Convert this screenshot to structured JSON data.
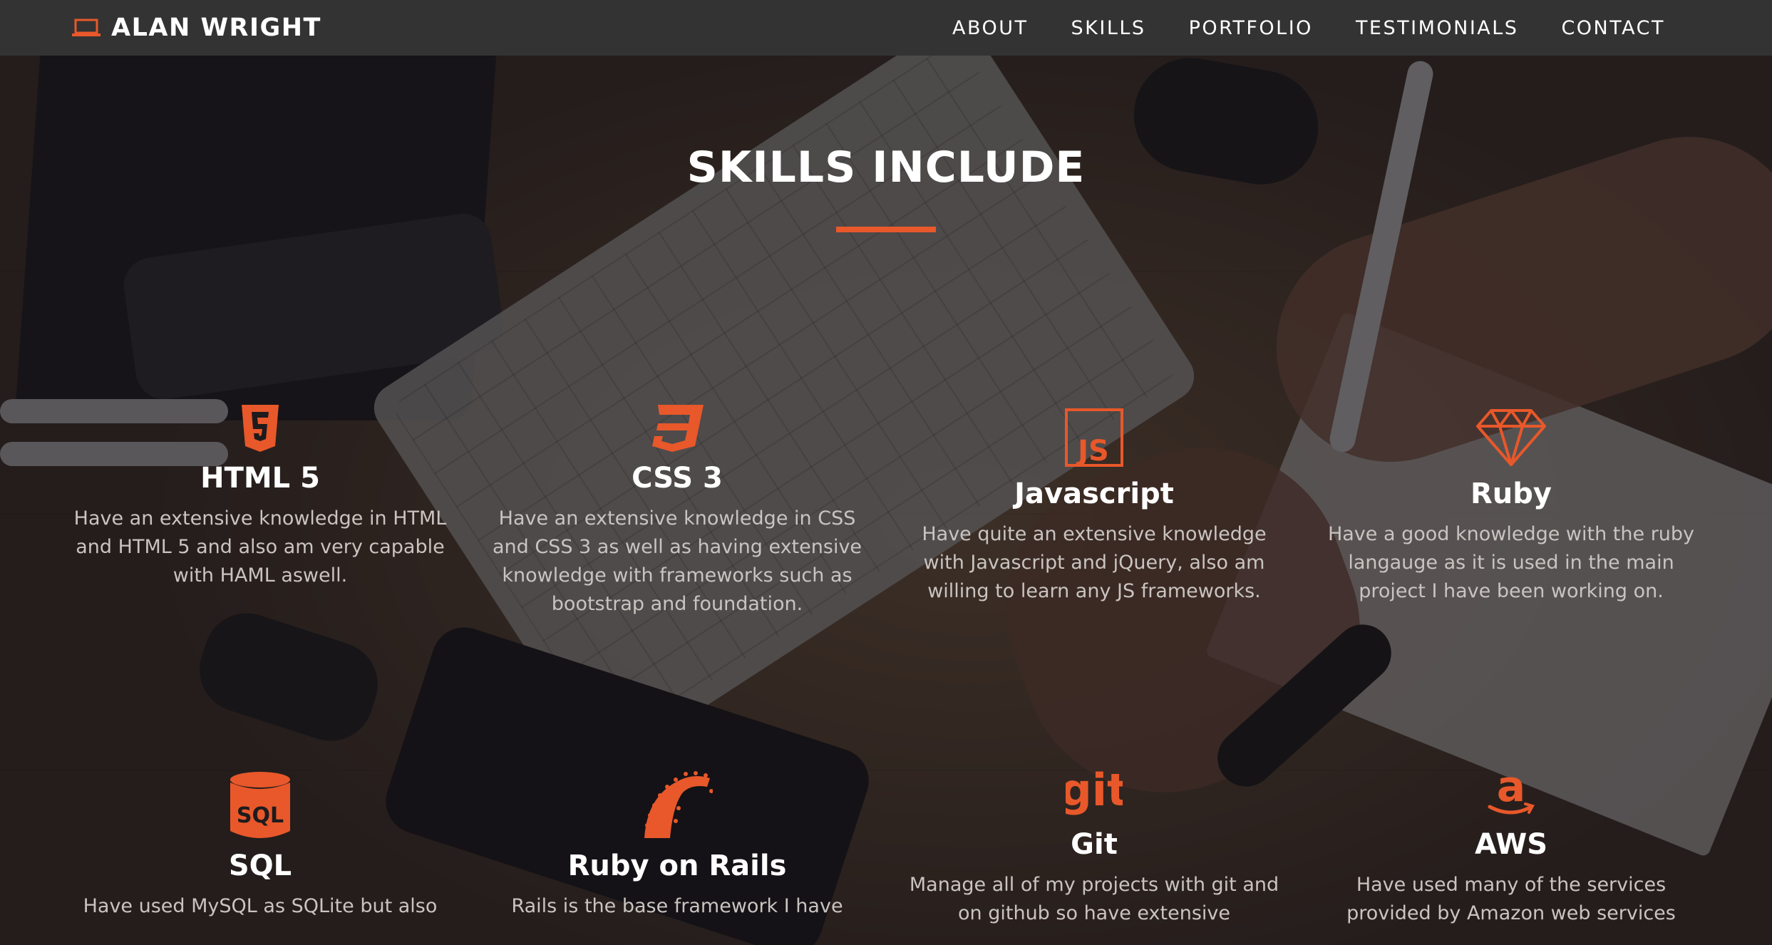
{
  "brand": {
    "name": "ALAN WRIGHT",
    "icon": "laptop-icon"
  },
  "nav": {
    "links": [
      "ABOUT",
      "SKILLS",
      "PORTFOLIO",
      "TESTIMONIALS",
      "CONTACT"
    ]
  },
  "section": {
    "title": "SKILLS INCLUDE"
  },
  "colors": {
    "accent": "#e8582a",
    "navbar": "#333333",
    "text": "#ffffff",
    "muted_text": "#c9c4c0"
  },
  "skills": [
    {
      "name": "HTML 5",
      "icon": "html5-icon",
      "description": "Have an extensive knowledge in HTML and HTML 5 and also am very capable with HAML aswell."
    },
    {
      "name": "CSS 3",
      "icon": "css3-icon",
      "description": "Have an extensive knowledge in CSS and CSS 3 as well as having extensive knowledge with frameworks such as bootstrap and foundation."
    },
    {
      "name": "Javascript",
      "icon": "javascript-icon",
      "description": "Have quite an extensive knowledge with Javascript and jQuery, also am willing to learn any JS frameworks."
    },
    {
      "name": "Ruby",
      "icon": "ruby-gem-icon",
      "description": "Have a good knowledge with the ruby langauge as it is used in the main project I have been working on."
    },
    {
      "name": "SQL",
      "icon": "sql-database-icon",
      "description": "Have used MySQL as SQLite but also"
    },
    {
      "name": "Ruby on Rails",
      "icon": "rails-icon",
      "description": "Rails is the base framework I have"
    },
    {
      "name": "Git",
      "icon": "git-icon",
      "description": "Manage all of my projects with git and on github so have extensive"
    },
    {
      "name": "AWS",
      "icon": "amazon-icon",
      "description": "Have used many of the services provided by Amazon web services"
    }
  ]
}
